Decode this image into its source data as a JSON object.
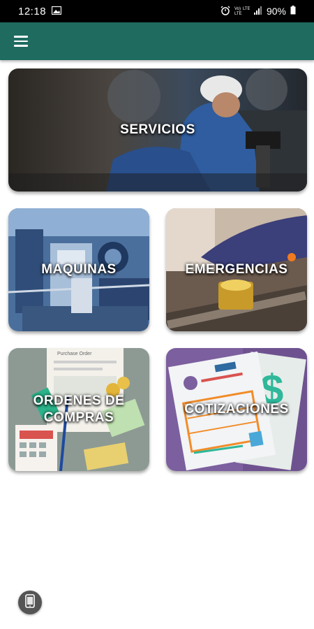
{
  "status_bar": {
    "time": "12:18",
    "battery": "90%",
    "network_label": "Vo) LTE"
  },
  "app_bar": {
    "menu_icon": "hamburger-menu-icon",
    "color": "#1f6b60"
  },
  "tiles": [
    {
      "label": "SERVICIOS",
      "image": "worker-machine-photo"
    },
    {
      "label": "MAQUINAS",
      "image": "industrial-machinery-photo"
    },
    {
      "label": "EMERGENCIAS",
      "image": "emergency-button-photo"
    },
    {
      "label": "ORDENES DE\nCOMPRAS",
      "image": "purchase-order-photo"
    },
    {
      "label": "COTIZACIONES",
      "image": "invoice-illustration"
    }
  ],
  "floating_button": {
    "icon": "phone-device-icon"
  }
}
